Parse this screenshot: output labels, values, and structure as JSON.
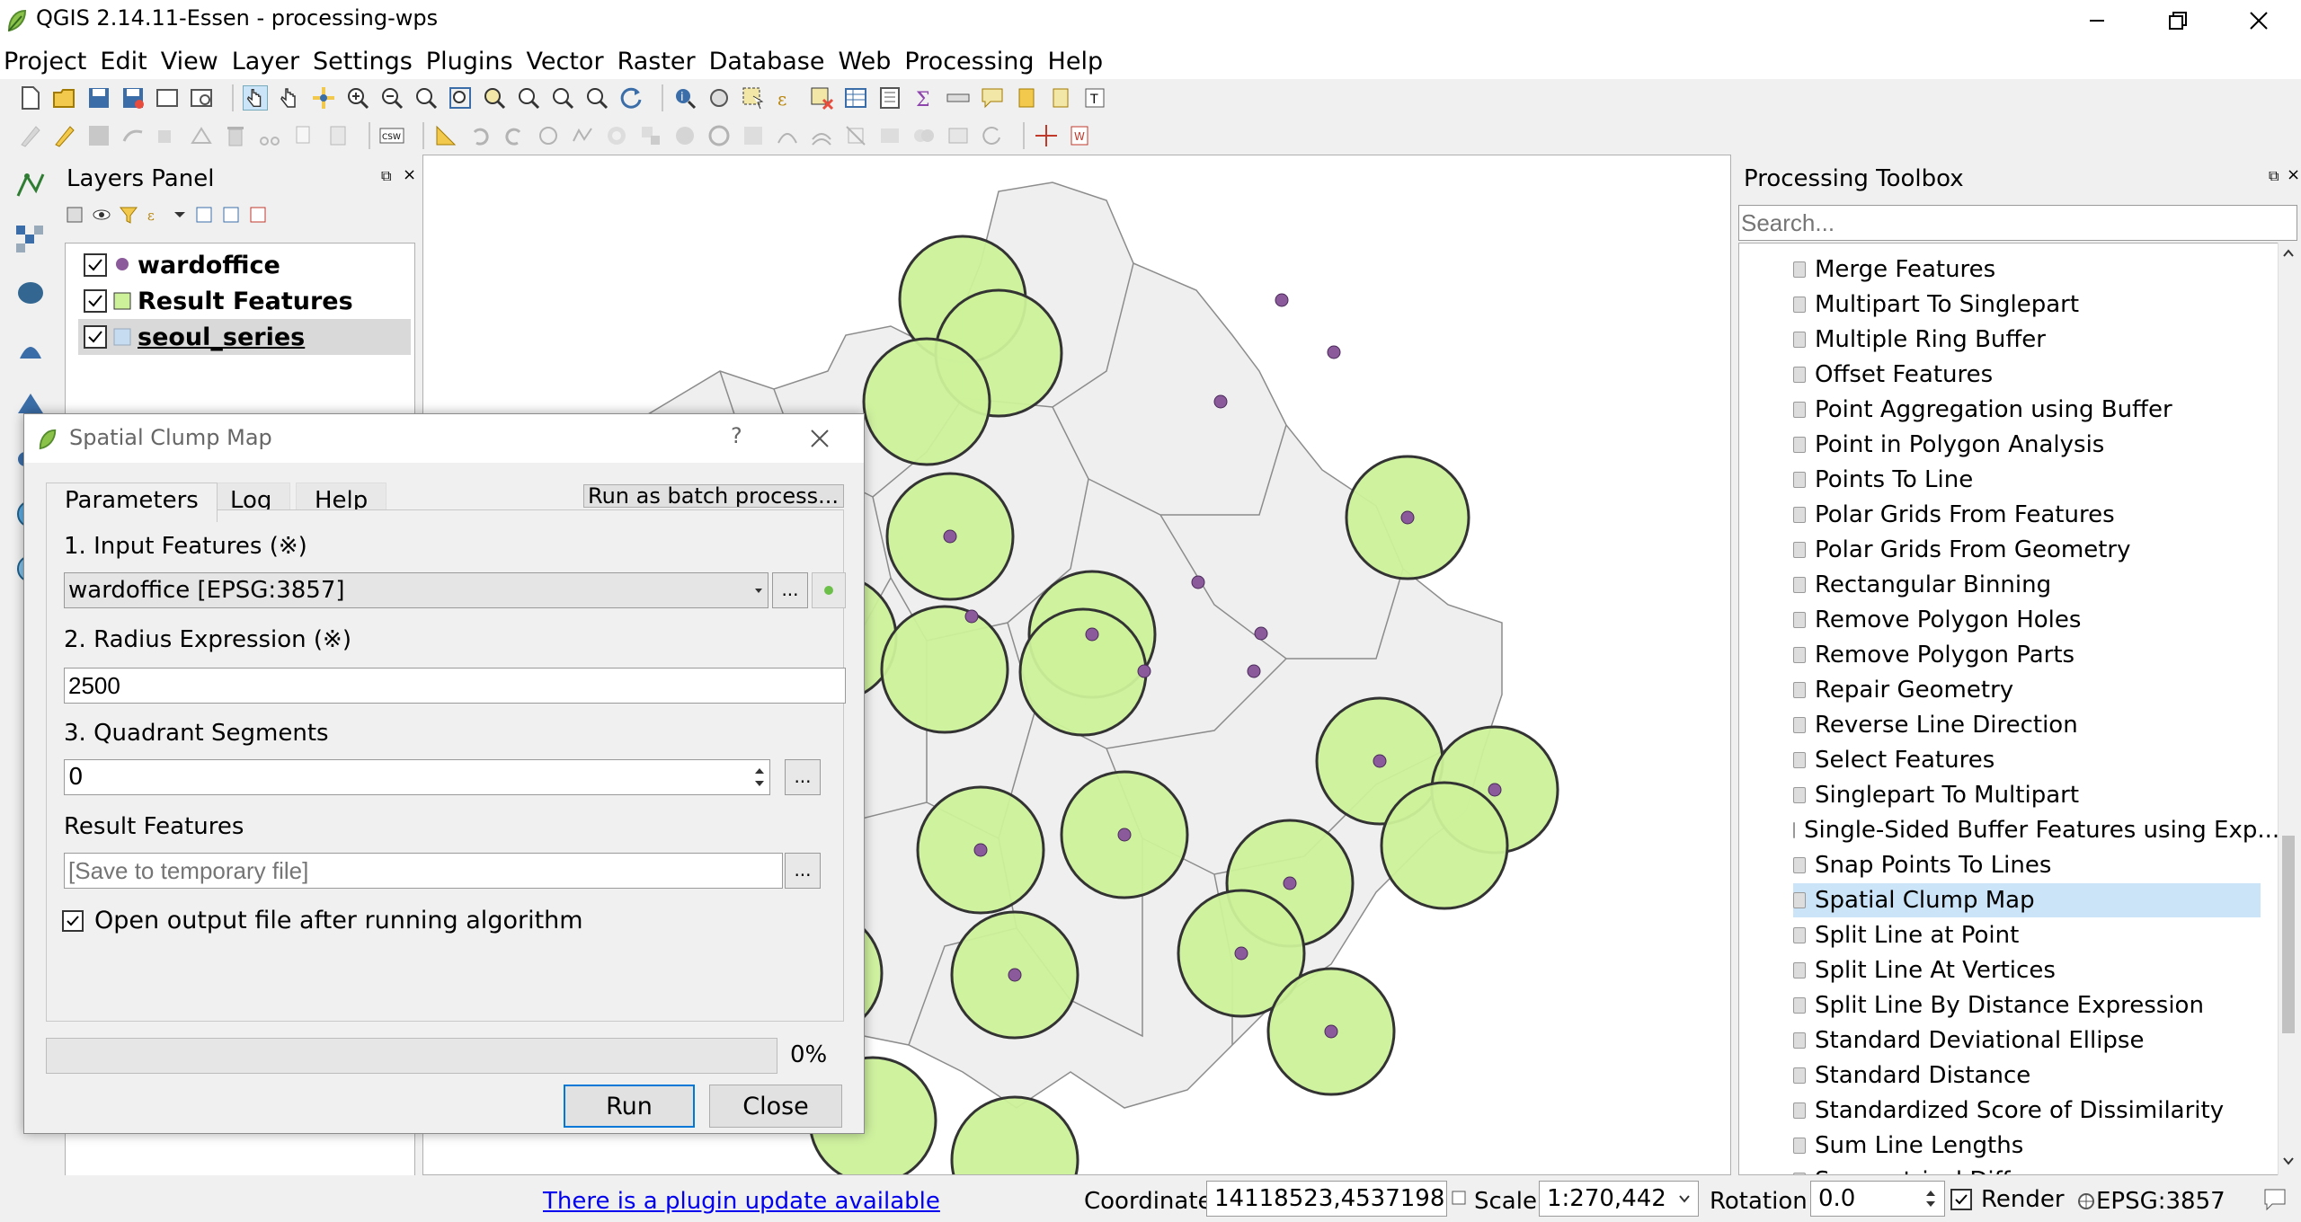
{
  "window": {
    "title": "QGIS 2.14.11-Essen - processing-wps"
  },
  "menubar": [
    "Project",
    "Edit",
    "View",
    "Layer",
    "Settings",
    "Plugins",
    "Vector",
    "Raster",
    "Database",
    "Web",
    "Processing",
    "Help"
  ],
  "layers_panel": {
    "title": "Layers Panel",
    "layers": [
      {
        "name": "wardoffice",
        "symbol": "point",
        "checked": true
      },
      {
        "name": "Result Features",
        "symbol": "polygon-green",
        "checked": true
      },
      {
        "name": "seoul_series",
        "symbol": "polygon-blue",
        "checked": true
      }
    ]
  },
  "toolbox": {
    "title": "Processing Toolbox",
    "search_placeholder": "Search...",
    "items": [
      "Merge Features",
      "Multipart To Singlepart",
      "Multiple Ring Buffer",
      "Offset Features",
      "Point Aggregation using Buffer",
      "Point in Polygon Analysis",
      "Points To Line",
      "Polar Grids From Features",
      "Polar Grids From Geometry",
      "Rectangular Binning",
      "Remove Polygon Holes",
      "Remove Polygon Parts",
      "Repair Geometry",
      "Reverse Line Direction",
      "Select Features",
      "Singlepart To Multipart",
      "Single-Sided Buffer Features using Exp...",
      "Snap Points To Lines",
      "Spatial Clump Map",
      "Split Line at Point",
      "Split Line At Vertices",
      "Split Line By Distance Expression",
      "Standard Deviational Ellipse",
      "Standard Distance",
      "Standardized Score of Dissimilarity",
      "Sum Line Lengths",
      "Symmetrical Difference"
    ],
    "selected": "Spatial Clump Map"
  },
  "dialog": {
    "title": "Spatial Clump Map",
    "help_glyph": "?",
    "tabs": [
      "Parameters",
      "Log",
      "Help"
    ],
    "batch_button": "Run as batch process...",
    "input_label": "1. Input Features (※)",
    "input_value": "wardoffice [EPSG:3857]",
    "radius_label": "2. Radius Expression (※)",
    "radius_value": "2500",
    "segments_label": "3. Quadrant Segments",
    "segments_value": "0",
    "result_label": "Result Features",
    "result_placeholder": "[Save to temporary file]",
    "open_output_label": "Open output file after running algorithm",
    "open_output_checked": true,
    "progress_text": "0%",
    "progress": 0,
    "run_label": "Run",
    "close_label": "Close",
    "ellipsis": "..."
  },
  "statusbar": {
    "plugin_link": "There is a plugin update available",
    "coordinate_label": "Coordinate",
    "coordinate_value": "14118523,4537198",
    "scale_label": "Scale",
    "scale_value": "1:270,442",
    "rotation_label": "Rotation",
    "rotation_value": "0.0",
    "render_label": "Render",
    "render_checked": true,
    "crs": "EPSG:3857"
  },
  "colors": {
    "buffer_fill": "#ccf19a",
    "point": "#8a5a9a",
    "district_fill": "#efefef",
    "selection": "#cce4f7",
    "link": "#0000ee"
  }
}
